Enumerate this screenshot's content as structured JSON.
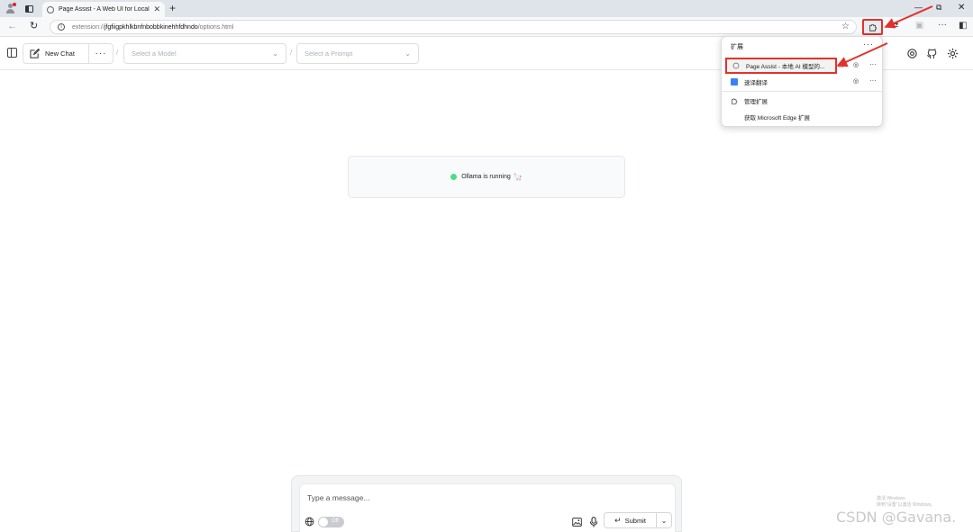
{
  "browser": {
    "tab": {
      "title": "Page Assist - A Web UI for Local AI",
      "close_glyph": "✕"
    },
    "new_tab_glyph": "+",
    "window_controls": {
      "minimize": "—",
      "restore": "⧉",
      "close": "✕"
    },
    "address": {
      "scheme": "extension://",
      "host": "jfgfiigpkhlkbnfnbobbkinehhfdhndo",
      "path": "/options.html"
    }
  },
  "extensions_panel": {
    "title": "扩展",
    "items": [
      {
        "label": "Page Assist - 本地 AI 模型的...",
        "highlighted": true
      },
      {
        "label": "速译翻译",
        "highlighted": false
      }
    ],
    "manage_label": "管理扩展",
    "get_label": "获取 Microsoft Edge 扩展"
  },
  "app_header": {
    "new_chat_label": "New Chat",
    "more_glyph": "···",
    "separator": "/",
    "model_placeholder": "Select a Model",
    "prompt_placeholder": "Select a Prompt"
  },
  "status": {
    "text": "Ollama is running",
    "emoji": "🦙",
    "color": "#4ade80"
  },
  "composer": {
    "placeholder": "Type a message...",
    "web_search_toggle": "Off",
    "submit_label": "Submit",
    "submit_glyph": "↵"
  },
  "watermarks": {
    "activate_line1": "激活 Windows",
    "activate_line2": "转到\"设置\"以激活 Windows。",
    "csdn": "CSDN @Gavana."
  },
  "colors": {
    "annotation_red": "#e3312a",
    "status_green": "#4ade80"
  }
}
